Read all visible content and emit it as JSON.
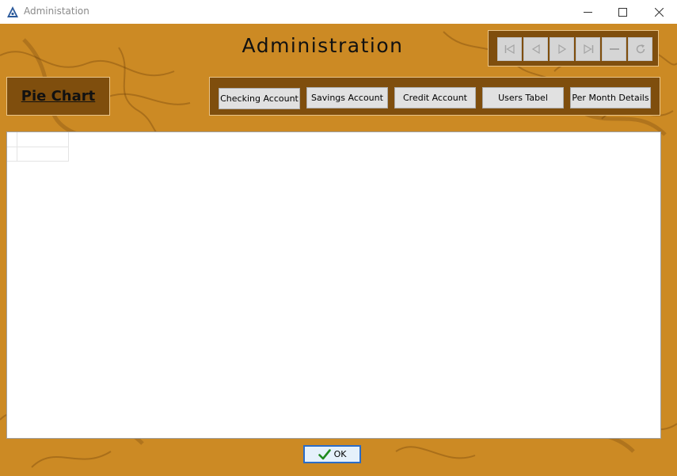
{
  "window": {
    "title": "Administation",
    "controls": [
      "minimize-icon",
      "maximize-icon",
      "close-icon"
    ]
  },
  "header": {
    "title": "Administration"
  },
  "navigator": {
    "buttons": [
      "first-record-icon",
      "previous-record-icon",
      "next-record-icon",
      "last-record-icon",
      "delete-record-icon",
      "refresh-icon"
    ]
  },
  "sidebar": {
    "pie_chart_label": "Pie Chart"
  },
  "toolbar": {
    "buttons": [
      {
        "label": "Checking Account"
      },
      {
        "label": "Savings Account"
      },
      {
        "label": "Credit Account"
      },
      {
        "label": "Users Tabel"
      },
      {
        "label": "Per Month Details"
      }
    ]
  },
  "footer": {
    "ok_label": "OK"
  },
  "colors": {
    "background": "#cc8a24",
    "panel": "#7f4e0d",
    "accent_border": "#2a6cc7"
  }
}
